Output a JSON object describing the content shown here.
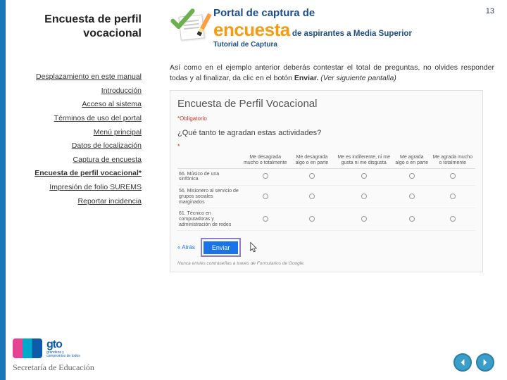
{
  "page_number": "13",
  "sidebar": {
    "title_line1": "Encuesta de perfil",
    "title_line2": "vocacional",
    "nav": [
      "Desplazamiento en este manual",
      "Introducción",
      "Acceso al sistema",
      "Términos de uso del portal",
      "Menú principal",
      "Datos de localización",
      "Captura de encuesta",
      "Encuesta de perfil vocacional*",
      "Impresión de folio SUREMS",
      "Reportar incidencia"
    ],
    "current_index": 7
  },
  "header": {
    "line1": "Portal de captura de",
    "big_word": "encuesta",
    "line2_rest": " de aspirantes a Media Superior",
    "subtitle": "Tutorial de Captura"
  },
  "instruction": {
    "text_a": "Así como en el ejemplo anterior deberás contestar el total de preguntas, no olvides responder todas y al finalizar, da clic en el botón ",
    "bold": "Enviar.",
    "italic": " (Ver siguiente pantalla)"
  },
  "screenshot": {
    "title": "Encuesta de Perfil Vocacional",
    "required": "*Obligatorio",
    "question": "¿Qué tanto te agradan estas actividades?",
    "asterisk": "*",
    "columns": [
      "Me desagrada mucho o totalmente",
      "Me desagrada algo o en parte",
      "Me es indiferente, ni me gusta ni me disgusta",
      "Me agrada algo o en parte",
      "Me agrada mucho o totalmente"
    ],
    "rows": [
      "66. Músico de una sinfónica",
      "56. Misionero al servicio de grupos sociales marginados",
      "61. Técnico en computadoras y administración de redes"
    ],
    "back": "« Atrás",
    "submit": "Enviar",
    "disclaimer": "Nunca envíes contraseñas a través de Formularios de Google."
  },
  "footer": {
    "gto": "gto",
    "gto_sub1": "grandeza y",
    "gto_sub2": "compromiso de todos",
    "secretaria": "Secretaría de Educación"
  }
}
